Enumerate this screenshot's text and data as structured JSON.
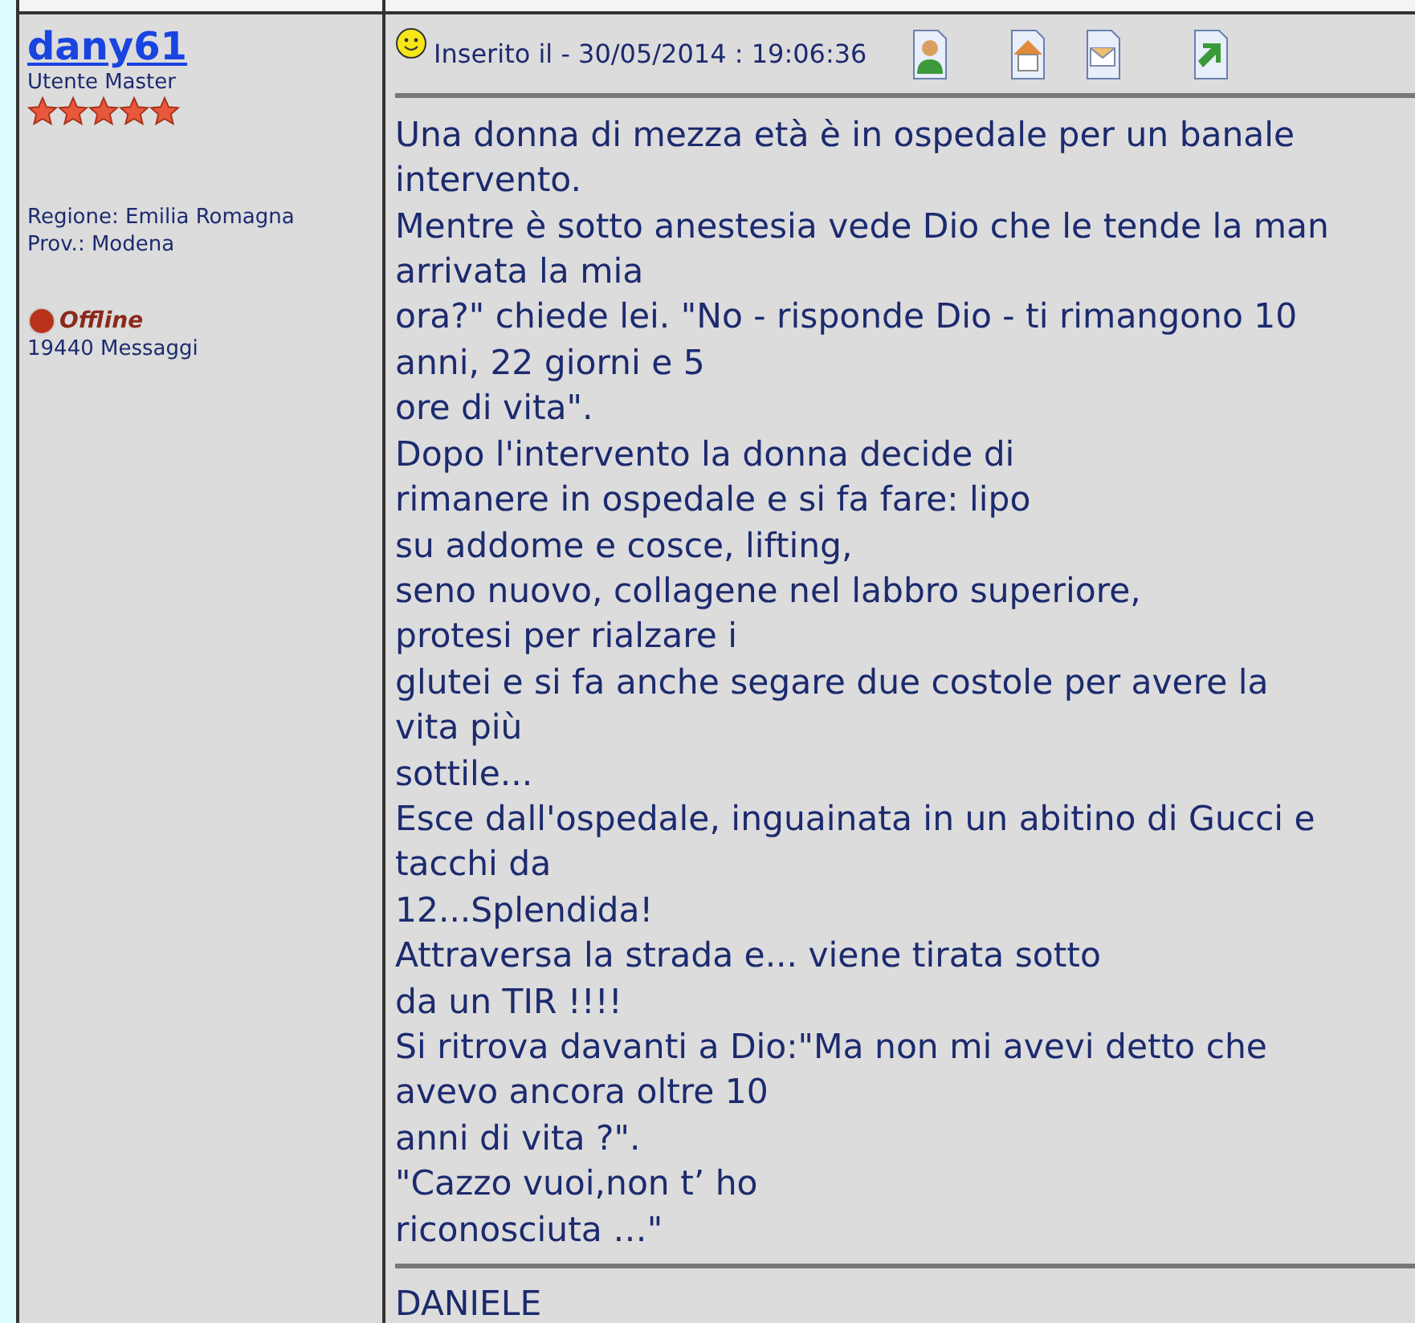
{
  "author": {
    "name": "dany61",
    "rank": "Utente Master",
    "stars": 5,
    "region": "Regione: Emilia Romagna",
    "province": "Prov.: Modena",
    "status": {
      "label": "Offline",
      "online": false
    },
    "posts": "19440 Messaggi"
  },
  "post": {
    "posted": "Inserito il - 30/05/2014 : 19:06:36",
    "lines": [
      "Una donna di mezza età è in ospedale per un banale",
      "intervento.",
      "Mentre è sotto anestesia vede Dio che le tende la man",
      "arrivata la mia",
      "ora?\" chiede lei. \"No - risponde Dio - ti rimangono 10",
      "anni, 22 giorni e 5",
      "ore di vita\".",
      "Dopo l'intervento la donna decide di",
      "rimanere in ospedale e si fa fare: lipo",
      "su addome e cosce, lifting,",
      "seno nuovo, collagene nel labbro superiore,",
      "protesi per rialzare i",
      "glutei e si fa anche segare due costole per avere la",
      "vita più",
      "sottile...",
      "Esce dall'ospedale, inguainata in un abitino di Gucci e",
      "tacchi da",
      "12...Splendida!",
      "Attraversa la strada e... viene tirata sotto",
      "da un TIR !!!!",
      "Si ritrova davanti a Dio:\"Ma non mi avevi detto che",
      "avevo ancora oltre 10",
      "anni di vita ?\".",
      "\"Cazzo vuoi,non t’ ho",
      "riconosciuta …\""
    ],
    "signature": "DANIELE"
  }
}
